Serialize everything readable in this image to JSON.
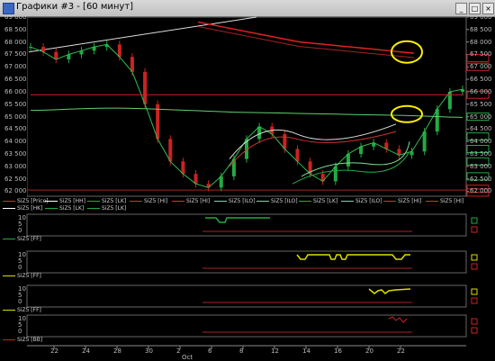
{
  "window": {
    "title": "Графики #3 - [60 минут]",
    "minimize_glyph": "_",
    "restore_glyph": "□",
    "close_glyph": "×"
  },
  "main_axis": {
    "ticks": [
      "69 000",
      "68 500",
      "68 000",
      "67 500",
      "67 000",
      "66 500",
      "66 000",
      "65 500",
      "65 000",
      "64 500",
      "64 000",
      "63 500",
      "63 000",
      "62 500",
      "62 000"
    ],
    "ylim": [
      61800,
      69000
    ]
  },
  "main_legend": {
    "row1": [
      {
        "label": "SiZ5 [Price]",
        "color": "#cc3333"
      },
      {
        "label": "SiZ5 [HH]",
        "color": "#ffffff"
      },
      {
        "label": "SiZ5 [LK]",
        "color": "#22aa44"
      },
      {
        "label": "SiZ5 [HI]",
        "color": "#cc3333"
      },
      {
        "label": "SiZ5 [HI]",
        "color": "#cc3333"
      },
      {
        "label": "SiZ5 [ILO]",
        "color": "#88ccaa"
      },
      {
        "label": "SiZ5 [ILO]",
        "color": "#88ccaa"
      },
      {
        "label": "SiZ5 [LK]",
        "color": "#22aa44"
      },
      {
        "label": "SiZ5 [ILO]",
        "color": "#88ccaa"
      },
      {
        "label": "SiZ5 [HI]",
        "color": "#cc3333"
      },
      {
        "label": "SiZ5 [HI]",
        "color": "#cc3333"
      }
    ],
    "row2": [
      {
        "label": "SiZ5 [HK]",
        "color": "#ffffff"
      },
      {
        "label": "SiZ5 [LK]",
        "color": "#22aa44"
      },
      {
        "label": "SiZ5 [LK]",
        "color": "#22aa44"
      }
    ]
  },
  "panes": [
    {
      "ticks": [
        "10",
        "5",
        "0"
      ],
      "legend": "SiZ5 [FF]",
      "line_color": "#22aa44"
    },
    {
      "ticks": [
        "10",
        "5",
        "0"
      ],
      "legend": "SiZ5 [FF]",
      "line_color": "#dddd00"
    },
    {
      "ticks": [
        "10",
        "5",
        "0"
      ],
      "legend": "SiZ5 [FF]",
      "line_color": "#dddd00"
    },
    {
      "ticks": [
        "10",
        "5",
        "0"
      ],
      "legend": "SiZ5 [BB]",
      "line_color": "#cc2222"
    }
  ],
  "x_axis": {
    "labels": [
      "22",
      "24",
      "28",
      "30",
      "2",
      "6",
      "8",
      "12",
      "14",
      "16",
      "20",
      "22"
    ],
    "month_label": "Oct"
  },
  "colors": {
    "up_candle": "#22aa44",
    "down_candle": "#cc2222",
    "highlight": "#ffee00"
  },
  "chart_data": {
    "type": "line",
    "title": "",
    "ylim": [
      61800,
      69000
    ],
    "series": [
      {
        "name": "SiZ5 [Price]",
        "values": [
          67800,
          67600,
          67300,
          67500,
          67650,
          67800,
          67900,
          67400,
          66800,
          65500,
          64100,
          63200,
          62700,
          62300,
          62150,
          62600,
          63300,
          64100,
          64600,
          64300,
          63700,
          63200,
          62700,
          62400,
          63000,
          63500,
          63800,
          63950,
          63700,
          63450,
          63600,
          64400,
          65300,
          66000,
          66100
        ]
      },
      {
        "name": "SiZ5 [HI]",
        "values": [
          65880,
          65880,
          65880,
          65880,
          65880,
          65880,
          65880,
          65880,
          65880,
          65880,
          65880,
          65880,
          65880,
          65880,
          65880,
          65880,
          65880,
          65880,
          65880,
          65880,
          65880,
          65880,
          65880,
          65880,
          65880,
          65880,
          65880,
          65880,
          65880,
          65880,
          65880,
          65880,
          65880,
          65880,
          65880
        ]
      },
      {
        "name": "SiZ5 [LK]",
        "values": [
          65250,
          65260,
          65280,
          65300,
          65320,
          65330,
          65340,
          65340,
          65330,
          65320,
          65300,
          65280,
          65260,
          65240,
          65220,
          65200,
          65180,
          65170,
          65160,
          65150,
          65140,
          65130,
          65120,
          65110,
          65100,
          65090,
          65080,
          65070,
          65060,
          65050,
          65040,
          65020,
          65000,
          64980,
          64970
        ]
      },
      {
        "name": "SiZ5 [HI]",
        "values": [
          68800,
          68700,
          68600,
          68500,
          68400,
          68300,
          68200,
          68100,
          68000,
          67950,
          67900,
          67850,
          67800,
          67750,
          67700,
          67650,
          67600,
          67550
        ]
      }
    ]
  }
}
